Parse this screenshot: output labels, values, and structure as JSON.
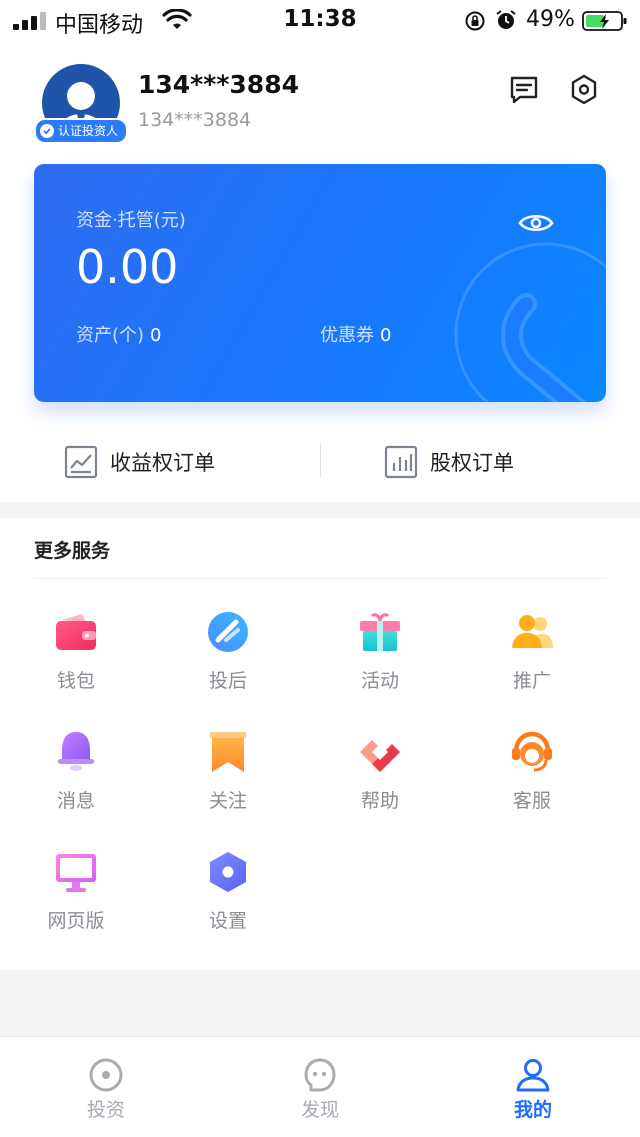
{
  "status_bar": {
    "carrier": "中国移动",
    "time": "11:38",
    "battery": "49%"
  },
  "profile": {
    "name": "134***3884",
    "phone": "134***3884",
    "badge": "认证投资人"
  },
  "card": {
    "label": "资金·托管(元)",
    "amount": "0.00",
    "assets_label": "资产(个)",
    "assets_value": "0",
    "coupon_label": "优惠券",
    "coupon_value": "0"
  },
  "orders": {
    "income_label": "收益权订单",
    "equity_label": "股权订单"
  },
  "services": {
    "title": "更多服务",
    "items": [
      {
        "label": "钱包",
        "icon": "wallet-icon"
      },
      {
        "label": "投后",
        "icon": "post-investment-icon"
      },
      {
        "label": "活动",
        "icon": "gift-icon"
      },
      {
        "label": "推广",
        "icon": "promote-icon"
      },
      {
        "label": "消息",
        "icon": "bell-icon"
      },
      {
        "label": "关注",
        "icon": "bookmark-icon"
      },
      {
        "label": "帮助",
        "icon": "help-icon"
      },
      {
        "label": "客服",
        "icon": "headset-icon"
      },
      {
        "label": "网页版",
        "icon": "monitor-icon"
      },
      {
        "label": "设置",
        "icon": "settings-hex-icon"
      }
    ]
  },
  "tabbar": {
    "items": [
      {
        "label": "投资",
        "icon": "compass-icon"
      },
      {
        "label": "发现",
        "icon": "discover-icon"
      },
      {
        "label": "我的",
        "icon": "person-icon",
        "active": true
      }
    ]
  },
  "colors": {
    "accent": "#1f6bff",
    "card_gradient_start": "#2f6cf0",
    "card_gradient_end": "#0a87ff"
  }
}
